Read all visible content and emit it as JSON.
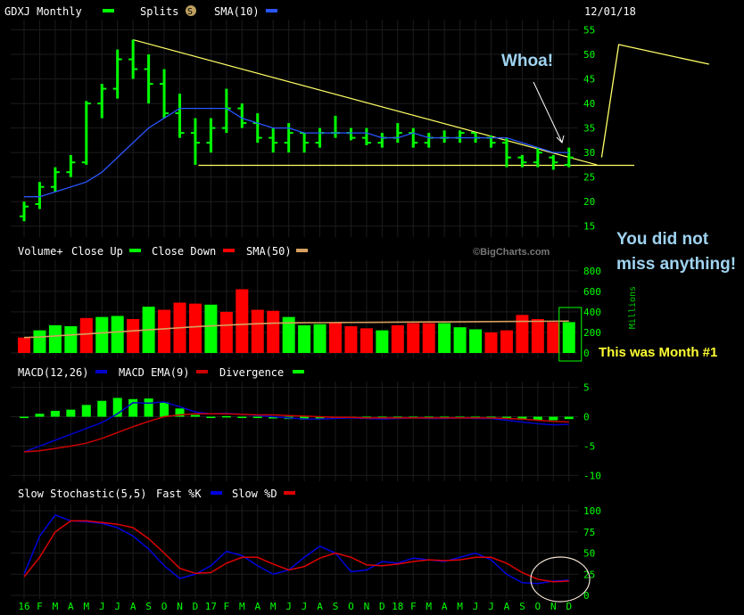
{
  "header": {
    "symbol": "GDXJ Monthly",
    "splits": "Splits",
    "splits_badge": "S",
    "sma": "SMA(10)",
    "date": "12/01/18"
  },
  "volume_header": {
    "label": "Volume+",
    "close_up": "Close Up",
    "close_down": "Close Down",
    "sma": "SMA(50)",
    "watermark": "©BigCharts.com",
    "unit": "Millions"
  },
  "macd_header": {
    "macd": "MACD(12,26)",
    "ema": "MACD EMA(9)",
    "divergence": "Divergence"
  },
  "stoch_header": {
    "title": "Slow Stochastic(5,5)",
    "fast": "Fast %K",
    "slow": "Slow %D"
  },
  "annotations": {
    "whoa": "Whoa!",
    "no_miss_1": "You did not",
    "no_miss_2": "miss anything!",
    "month1": "This was Month #1"
  },
  "colors": {
    "up": "#00ff00",
    "down": "#ff0000",
    "sma": "#2a55ff",
    "trend": "#ffff66",
    "ma50": "#d8a060",
    "macd_line": "#0000cc",
    "macd_signal": "#cc0000",
    "stoch_k": "#0000dd",
    "stoch_d": "#dd0000"
  },
  "chart_data": [
    {
      "type": "ohlc",
      "title": "GDXJ Monthly",
      "x": [
        "16",
        "F",
        "M",
        "A",
        "M",
        "J",
        "J",
        "A",
        "S",
        "O",
        "N",
        "D",
        "17",
        "F",
        "M",
        "A",
        "M",
        "J",
        "J",
        "A",
        "S",
        "O",
        "N",
        "D",
        "18",
        "F",
        "M",
        "A",
        "M",
        "J",
        "J",
        "A",
        "S",
        "O",
        "N",
        "D"
      ],
      "yticks": [
        15,
        20,
        25,
        30,
        35,
        40,
        45,
        50,
        55
      ],
      "ylim": [
        13.5,
        56
      ],
      "ohlc": [
        [
          17,
          20,
          16,
          19
        ],
        [
          19.5,
          24,
          18.5,
          23
        ],
        [
          23,
          27,
          22,
          26
        ],
        [
          26,
          29.5,
          25,
          28
        ],
        [
          28,
          40.5,
          27.5,
          40
        ],
        [
          40,
          44,
          37,
          43
        ],
        [
          43,
          51,
          41,
          49
        ],
        [
          49,
          53,
          45,
          47
        ],
        [
          47,
          50,
          40,
          44
        ],
        [
          44,
          47,
          37,
          38
        ],
        [
          38,
          42,
          33,
          34
        ],
        [
          34,
          37,
          27.5,
          32
        ],
        [
          32,
          37,
          30,
          35
        ],
        [
          35,
          43,
          34,
          39
        ],
        [
          39,
          40,
          35,
          36
        ],
        [
          36,
          38,
          32,
          33
        ],
        [
          33,
          35,
          30,
          32
        ],
        [
          32,
          36,
          30,
          34
        ],
        [
          34,
          34,
          30,
          32
        ],
        [
          32,
          35,
          31,
          34
        ],
        [
          34,
          37.5,
          33,
          34
        ],
        [
          34,
          35,
          32.5,
          33
        ],
        [
          33,
          35,
          31.5,
          32
        ],
        [
          32,
          34,
          31,
          33
        ],
        [
          33,
          36,
          32,
          34
        ],
        [
          34,
          35,
          31,
          32
        ],
        [
          32,
          34,
          31,
          33
        ],
        [
          33,
          34.5,
          32,
          33
        ],
        [
          33,
          34.5,
          32,
          34
        ],
        [
          34,
          34,
          32,
          33
        ],
        [
          33,
          33.5,
          31,
          32
        ],
        [
          32,
          33,
          27,
          29
        ],
        [
          29,
          29.5,
          27,
          28
        ],
        [
          28,
          31,
          27,
          30
        ],
        [
          29,
          29.5,
          26.5,
          28
        ],
        [
          27.5,
          31,
          27,
          29
        ]
      ],
      "sma_values": [
        21,
        21,
        22,
        23,
        24,
        26,
        29,
        32,
        35,
        37,
        39,
        39,
        39,
        39,
        37,
        36,
        35,
        35,
        34,
        34,
        34,
        34,
        34,
        33,
        33,
        34,
        33,
        33,
        33,
        33,
        33,
        33,
        32,
        31,
        30,
        30
      ],
      "trendlines": [
        {
          "from": [
            7,
            53
          ],
          "to": [
            36.8,
            27.5
          ]
        },
        {
          "from": [
            11.2,
            27.4
          ],
          "to": [
            39.2,
            27.4
          ]
        }
      ],
      "projection": [
        [
          37.1,
          29
        ],
        [
          38.2,
          52
        ],
        [
          44,
          48
        ]
      ]
    },
    {
      "type": "bar",
      "title": "Volume+",
      "series_unit": "Millions",
      "yticks": [
        0,
        200,
        400,
        600,
        800
      ],
      "ylim": [
        0,
        850
      ],
      "values": [
        150,
        220,
        270,
        260,
        340,
        350,
        360,
        330,
        450,
        420,
        490,
        480,
        470,
        400,
        620,
        420,
        410,
        350,
        270,
        280,
        300,
        260,
        240,
        220,
        270,
        290,
        290,
        290,
        250,
        230,
        200,
        220,
        370,
        330,
        300,
        300
      ],
      "up": [
        false,
        true,
        true,
        true,
        false,
        true,
        true,
        false,
        true,
        false,
        false,
        false,
        true,
        false,
        false,
        false,
        false,
        true,
        true,
        true,
        false,
        false,
        false,
        true,
        false,
        false,
        false,
        true,
        true,
        true,
        false,
        false,
        false,
        false,
        false,
        true
      ],
      "ma50": [
        150,
        155,
        165,
        175,
        185,
        195,
        205,
        215,
        225,
        235,
        245,
        255,
        263,
        270,
        278,
        285,
        290,
        292,
        294,
        295,
        296,
        297,
        298,
        299,
        300,
        301,
        302,
        302,
        303,
        304,
        305,
        306,
        307,
        308,
        309,
        310
      ]
    },
    {
      "type": "line",
      "title": "MACD(12,26)",
      "yticks": [
        5,
        0,
        -5,
        -10
      ],
      "ylim": [
        -11,
        6
      ],
      "macd": [
        -6,
        -5,
        -4,
        -3,
        -2,
        -1,
        0.5,
        2.4,
        2.3,
        2.5,
        1.7,
        0.8,
        0.5,
        0.6,
        0.4,
        0.2,
        0,
        -0.2,
        -0.4,
        -0.4,
        -0.3,
        -0.2,
        -0.3,
        -0.4,
        -0.3,
        -0.2,
        -0.3,
        -0.3,
        -0.2,
        -0.3,
        -0.3,
        -0.6,
        -0.9,
        -1.2,
        -1.4,
        -1.3
      ],
      "signal": [
        -6,
        -5.8,
        -5.4,
        -5,
        -4.5,
        -3.7,
        -2.7,
        -1.7,
        -0.8,
        0,
        0.3,
        0.5,
        0.5,
        0.5,
        0.4,
        0.3,
        0.3,
        0.2,
        0.1,
        0,
        -0.1,
        -0.1,
        -0.2,
        -0.2,
        -0.2,
        -0.2,
        -0.2,
        -0.2,
        -0.2,
        -0.2,
        -0.2,
        -0.3,
        -0.4,
        -0.6,
        -0.8,
        -0.9
      ],
      "divergence": [
        0,
        0.5,
        1,
        1.2,
        2,
        2.7,
        3.2,
        3,
        3.1,
        2.5,
        1.4,
        0.3,
        0,
        0.1,
        0,
        -0.1,
        -0.3,
        -0.4,
        -0.5,
        -0.4,
        -0.2,
        -0.1,
        -0.1,
        -0.2,
        -0.1,
        0,
        -0.1,
        -0.1,
        0,
        -0.1,
        -0.1,
        -0.3,
        -0.5,
        -0.6,
        -0.6,
        -0.4
      ]
    },
    {
      "type": "line",
      "title": "Slow Stochastic(5,5)",
      "yticks": [
        100,
        75,
        50,
        25,
        0
      ],
      "ylim": [
        0,
        100
      ],
      "k": [
        25,
        70,
        95,
        88,
        87,
        85,
        80,
        70,
        55,
        35,
        20,
        25,
        35,
        52,
        47,
        35,
        25,
        30,
        45,
        58,
        50,
        28,
        30,
        40,
        38,
        44,
        42,
        40,
        45,
        50,
        42,
        25,
        15,
        14,
        17,
        18
      ],
      "d": [
        22,
        45,
        75,
        88,
        88,
        86,
        84,
        80,
        67,
        50,
        32,
        26,
        27,
        38,
        45,
        45,
        37,
        30,
        34,
        44,
        50,
        45,
        36,
        35,
        37,
        40,
        42,
        41,
        42,
        45,
        45,
        38,
        27,
        19,
        16,
        17
      ]
    }
  ]
}
